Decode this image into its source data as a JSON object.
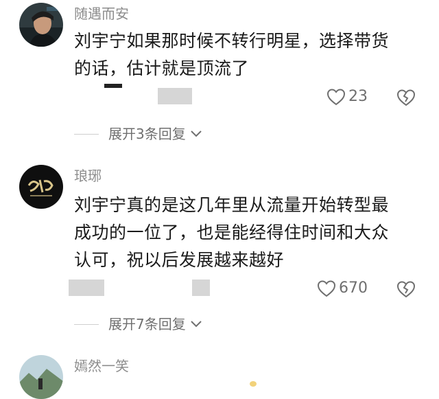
{
  "comments": [
    {
      "username": "随遇而安",
      "lines": [
        "刘宇宁如果那时候不转行明星，选择带货",
        "的话，估计就是顶流了"
      ],
      "likes": "23",
      "avatar_icon": "avatar-man-portrait",
      "reply_label": "展开3条回复"
    },
    {
      "username": "琅琊",
      "lines": [
        "刘宇宁真的是这几年里从流量开始转型最",
        "成功的一位了，也是能经得住时间和大众",
        "认可，祝以后发展越来越好"
      ],
      "likes": "670",
      "avatar_icon": "avatar-calligraphy-logo",
      "reply_label": "展开7条回复"
    },
    {
      "username": "嫣然一笑",
      "avatar_icon": "avatar-landscape"
    }
  ],
  "icons": {
    "like": "heart-outline-icon",
    "dislike": "broken-heart-icon",
    "expand": "chevron-down-icon"
  },
  "colors": {
    "username": "#8c8c8c",
    "text": "#1a1a1a",
    "meta": "#6f6f6f"
  }
}
